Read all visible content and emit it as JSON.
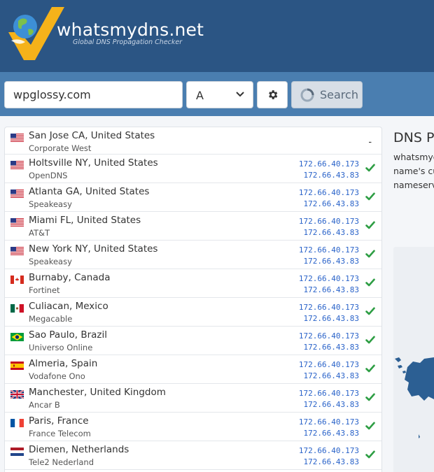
{
  "header": {
    "logo_text": "whatsmydns.net",
    "tagline": "Global DNS Propagation Checker"
  },
  "search": {
    "domain_value": "wpglossy.com",
    "record_type": "A",
    "settings_icon": "gear-icon",
    "search_label": "Search",
    "search_icon": "spinner-icon"
  },
  "results": [
    {
      "flag": "us",
      "location": "San Jose CA, United States",
      "provider": "Corporate West",
      "ips": [],
      "status": "-"
    },
    {
      "flag": "us",
      "location": "Holtsville NY, United States",
      "provider": "OpenDNS",
      "ips": [
        "172.66.40.173",
        "172.66.43.83"
      ],
      "status": "ok"
    },
    {
      "flag": "us",
      "location": "Atlanta GA, United States",
      "provider": "Speakeasy",
      "ips": [
        "172.66.40.173",
        "172.66.43.83"
      ],
      "status": "ok"
    },
    {
      "flag": "us",
      "location": "Miami FL, United States",
      "provider": "AT&T",
      "ips": [
        "172.66.40.173",
        "172.66.43.83"
      ],
      "status": "ok"
    },
    {
      "flag": "us",
      "location": "New York NY, United States",
      "provider": "Speakeasy",
      "ips": [
        "172.66.40.173",
        "172.66.43.83"
      ],
      "status": "ok"
    },
    {
      "flag": "ca",
      "location": "Burnaby, Canada",
      "provider": "Fortinet",
      "ips": [
        "172.66.40.173",
        "172.66.43.83"
      ],
      "status": "ok"
    },
    {
      "flag": "mx",
      "location": "Culiacan, Mexico",
      "provider": "Megacable",
      "ips": [
        "172.66.40.173",
        "172.66.43.83"
      ],
      "status": "ok"
    },
    {
      "flag": "br",
      "location": "Sao Paulo, Brazil",
      "provider": "Universo Online",
      "ips": [
        "172.66.40.173",
        "172.66.43.83"
      ],
      "status": "ok"
    },
    {
      "flag": "es",
      "location": "Almeria, Spain",
      "provider": "Vodafone Ono",
      "ips": [
        "172.66.40.173",
        "172.66.43.83"
      ],
      "status": "ok"
    },
    {
      "flag": "gb",
      "location": "Manchester, United Kingdom",
      "provider": "Ancar B",
      "ips": [
        "172.66.40.173",
        "172.66.43.83"
      ],
      "status": "ok"
    },
    {
      "flag": "fr",
      "location": "Paris, France",
      "provider": "France Telecom",
      "ips": [
        "172.66.40.173",
        "172.66.43.83"
      ],
      "status": "ok"
    },
    {
      "flag": "nl",
      "location": "Diemen, Netherlands",
      "provider": "Tele2 Nederland",
      "ips": [
        "172.66.40.173",
        "172.66.43.83"
      ],
      "status": "ok"
    }
  ],
  "info": {
    "title": "DNS Pr",
    "lines": [
      "whatsmyd",
      "name's cu",
      "nameserv"
    ]
  },
  "colors": {
    "header_bg": "#2b5584",
    "searchbar_bg": "#4a7eb0",
    "ip_link": "#2a63c9",
    "check_green": "#2e9e44",
    "map_land": "#2c5f93"
  }
}
